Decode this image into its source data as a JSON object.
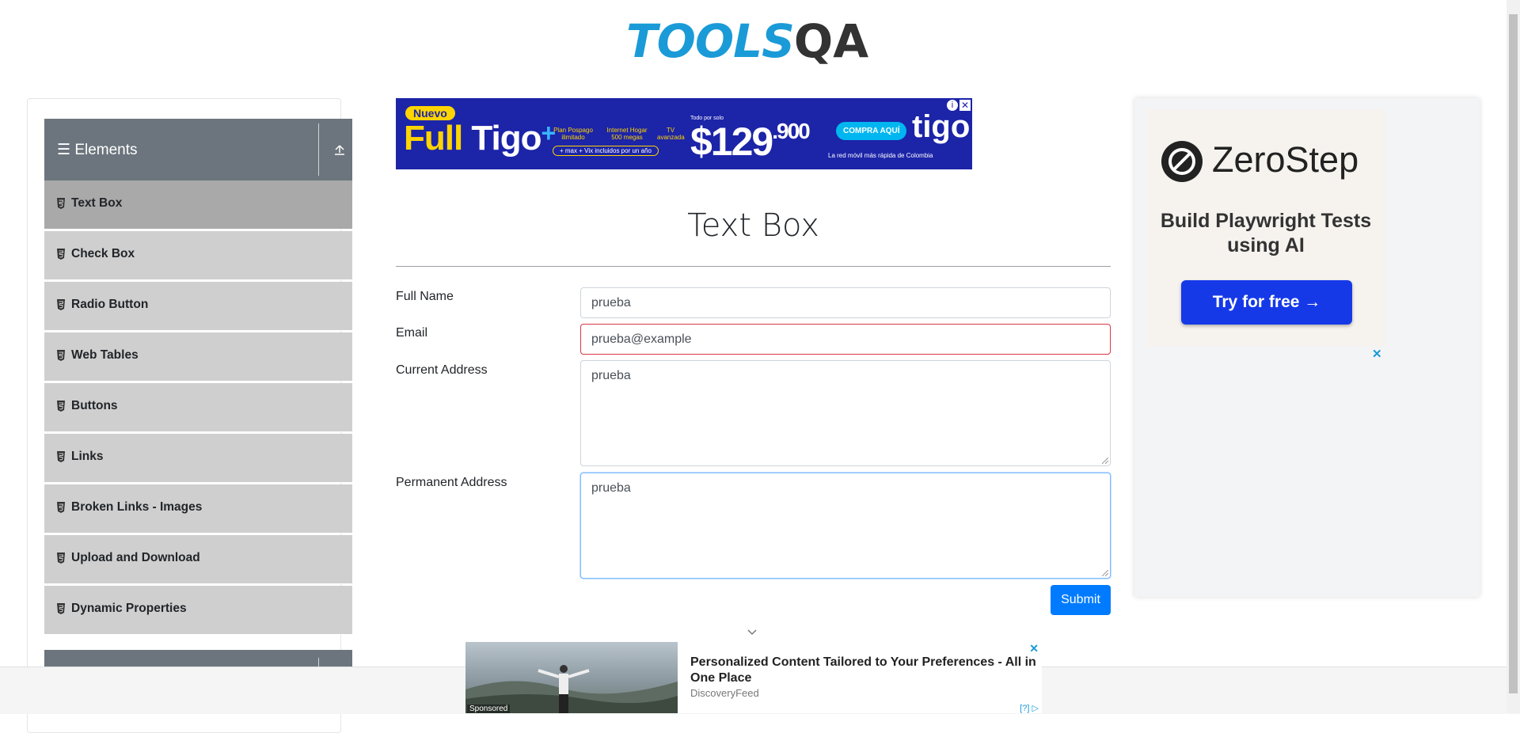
{
  "logo": {
    "text_a": "TOOLS",
    "text_b": "QA"
  },
  "sidebar": {
    "group_title": "Elements",
    "items": [
      {
        "label": "Text Box",
        "active": true
      },
      {
        "label": "Check Box"
      },
      {
        "label": "Radio Button"
      },
      {
        "label": "Web Tables"
      },
      {
        "label": "Buttons"
      },
      {
        "label": "Links"
      },
      {
        "label": "Broken Links - Images"
      },
      {
        "label": "Upload and Download"
      },
      {
        "label": "Dynamic Properties"
      }
    ]
  },
  "top_ad": {
    "badge": "Nuevo",
    "brand": "Full Tigo",
    "plus": "+",
    "line1": "Plan Pospago ilimitado",
    "line2": "Internet Hogar 500 megas",
    "line3": "TV avanzada",
    "extras": "+ max + Vix incluidos por un año",
    "price_prefix": "Todo por solo",
    "price": "$129",
    "price_dec": ".900",
    "cta": "COMPRA AQUÍ",
    "logo": "tigo",
    "tagline": "La red móvil más rápida de Colombia"
  },
  "main": {
    "title": "Text Box",
    "fields": {
      "full_name_label": "Full Name",
      "full_name_value": "prueba",
      "email_label": "Email",
      "email_value": "prueba@example",
      "current_address_label": "Current Address",
      "current_address_value": "prueba",
      "permanent_address_label": "Permanent Address",
      "permanent_address_value": "prueba"
    },
    "submit": "Submit"
  },
  "right_ad": {
    "brand": "ZeroStep",
    "tagline": "Build Playwright Tests using AI",
    "cta": "Try for free →",
    "close": "✕"
  },
  "bottom_ad": {
    "sponsored": "Sponsored",
    "title": "Personalized Content Tailored to Your Preferences - All in One Place",
    "source": "DiscoveryFeed",
    "close": "✕",
    "help": "[?]"
  },
  "colors": {
    "accent": "#007bff",
    "sidebar_group": "#6c757d",
    "sidebar_item": "#cfcfcf",
    "sidebar_active": "#a9a9a9",
    "logo_blue": "#1a9bd7"
  }
}
